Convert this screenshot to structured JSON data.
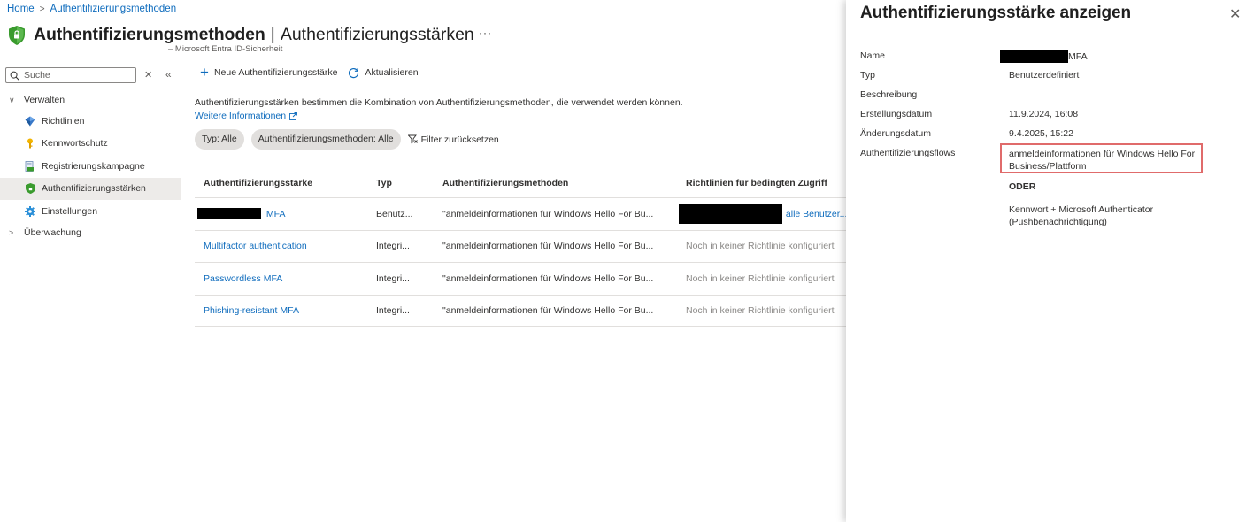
{
  "breadcrumb": {
    "home": "Home",
    "current": "Authentifizierungsmethoden"
  },
  "header": {
    "title": "Authentifizierungsmethoden",
    "subtitle": "Authentifizierungsstärken",
    "caption": "– Microsoft Entra ID-Sicherheit",
    "more": "···"
  },
  "sidebar": {
    "search_placeholder": "Suche",
    "groups": [
      {
        "label": "Verwalten",
        "expanded": true
      },
      {
        "label": "Überwachung",
        "expanded": false
      }
    ],
    "items": [
      {
        "label": "Richtlinien",
        "icon": "policy-icon"
      },
      {
        "label": "Kennwortschutz",
        "icon": "key-icon"
      },
      {
        "label": "Registrierungskampagne",
        "icon": "campaign-icon"
      },
      {
        "label": "Authentifizierungsstärken",
        "icon": "shield-icon",
        "active": true
      },
      {
        "label": "Einstellungen",
        "icon": "gear-icon"
      }
    ]
  },
  "toolbar": {
    "new_label": "Neue Authentifizierungsstärke",
    "refresh_label": "Aktualisieren"
  },
  "main": {
    "description": "Authentifizierungsstärken bestimmen die Kombination von Authentifizierungsmethoden, die verwendet werden können.",
    "more_info": "Weitere Informationen",
    "filters": [
      "Typ: Alle",
      "Authentifizierungsmethoden: Alle"
    ],
    "reset_filters": "Filter zurücksetzen"
  },
  "table": {
    "headers": [
      "Authentifizierungsstärke",
      "Typ",
      "Authentifizierungsmethoden",
      "Richtlinien für bedingten Zugriff"
    ],
    "rows": [
      {
        "name": "MFA",
        "type": "Benutz...",
        "methods": "\"anmeldeinformationen für Windows Hello For Bu...",
        "policies": "alle Benutzer...",
        "redacted": true
      },
      {
        "name": "Multifactor authentication",
        "type": "Integri...",
        "methods": "\"anmeldeinformationen für Windows Hello For Bu...",
        "policies": "Noch in keiner Richtlinie konfiguriert"
      },
      {
        "name": "Passwordless MFA",
        "type": "Integri...",
        "methods": "\"anmeldeinformationen für Windows Hello For Bu...",
        "policies": "Noch in keiner Richtlinie konfiguriert"
      },
      {
        "name": "Phishing-resistant MFA",
        "type": "Integri...",
        "methods": "\"anmeldeinformationen für Windows Hello For Bu...",
        "policies": "Noch in keiner Richtlinie konfiguriert"
      }
    ]
  },
  "panel": {
    "title": "Authentifizierungsstärke anzeigen",
    "close": "✕",
    "labels": {
      "name": "Name",
      "type": "Typ",
      "description": "Beschreibung",
      "created": "Erstellungsdatum",
      "modified": "Änderungsdatum",
      "flows": "Authentifizierungsflows"
    },
    "values": {
      "name": "MFA",
      "type": "Benutzerdefiniert",
      "created": "11.9.2024, 16:08",
      "modified": "9.4.2025, 15:22",
      "flow1": "anmeldeinformationen für Windows Hello For Business/Plattform",
      "or": "ODER",
      "flow2": "Kennwort + Microsoft Authenticator (Pushbenachrichtigung)"
    }
  },
  "colors": {
    "link": "#0f6cbd",
    "highlight_border": "#e06b6b",
    "active_nav": "#edebe9"
  }
}
